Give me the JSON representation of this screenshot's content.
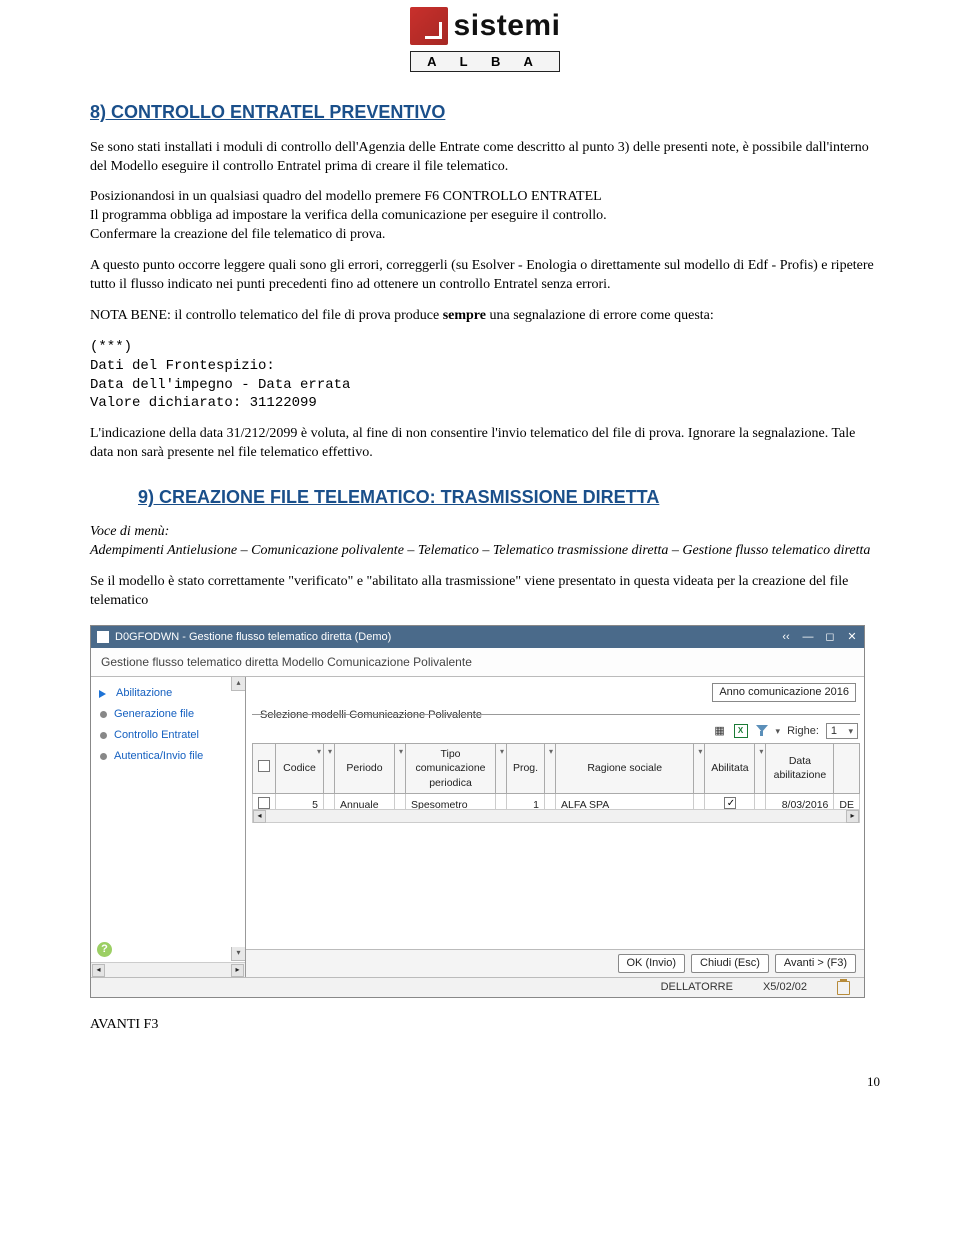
{
  "logo": {
    "brand": "sistemi",
    "bar": "A L B A"
  },
  "h8": "8)  CONTROLLO ENTRATEL PREVENTIVO",
  "p1": "Se sono stati installati i moduli di controllo dell'Agenzia delle Entrate come descritto al punto 3) delle presenti note, è possibile dall'interno del Modello eseguire il controllo Entratel prima di creare il file telematico.",
  "p2a": "Posizionandosi in un qualsiasi quadro del modello premere F6 CONTROLLO ENTRATEL",
  "p2b": "Il programma obbliga ad impostare la verifica della comunicazione per eseguire il controllo.",
  "p2c": "Confermare la creazione del file telematico di prova.",
  "p3": "A questo punto occorre leggere quali sono gli errori, correggerli (su Esolver - Enologia o direttamente sul modello di Edf - Profis) e ripetere tutto il flusso indicato nei punti precedenti fino ad ottenere un controllo Entratel senza errori.",
  "p4a": "NOTA BENE: il controllo telematico del file di prova produce ",
  "p4b": "sempre",
  "p4c": " una segnalazione di errore come questa:",
  "mono": {
    "l1": "(***)",
    "l2": "Dati del Frontespizio:",
    "l3": "Data dell'impegno - Data errata",
    "l4": "Valore dichiarato: 31122099"
  },
  "p5": "L'indicazione della data 31/212/2099 è voluta, al fine di non consentire l'invio telematico del file di prova. Ignorare la segnalazione. Tale data non sarà presente nel file telematico effettivo.",
  "h9": "9)  CREAZIONE FILE TELEMATICO: TRASMISSIONE DIRETTA",
  "voce": "Voce di menù:",
  "voce_path": "Adempimenti Antielusione – Comunicazione polivalente – Telematico – Telematico trasmissione diretta – Gestione flusso telematico diretta",
  "p6": "Se il modello è stato correttamente \"verificato\" e \"abilitato alla trasmissione\" viene presentato in questa videata per la creazione del file telematico",
  "app": {
    "title": "D0GFODWN - Gestione flusso telematico diretta  (Demo)",
    "subtitle": "Gestione flusso telematico diretta Modello Comunicazione Polivalente",
    "sidebar": {
      "items": [
        "Abilitazione",
        "Generazione file",
        "Controllo Entratel",
        "Autentica/Invio file"
      ]
    },
    "anno": "Anno comunicazione 2016",
    "section_label": "Selezione modelli Comunicazione Polivalente",
    "tools": {
      "righe_label": "Righe:",
      "righe_val": "1"
    },
    "grid": {
      "headers": [
        "",
        "Codice",
        "",
        "Periodo",
        "",
        "Tipo comunicazione periodica",
        "",
        "Prog.",
        "",
        "Ragione sociale",
        "",
        "Abilitata",
        "",
        "Data abilitazione",
        ""
      ],
      "row": {
        "codice": "5",
        "periodo": "Annuale",
        "tipo": "Spesometro",
        "prog": "1",
        "ragione": "ALFA SPA",
        "abil": true,
        "data_abil": "8/03/2016",
        "extra": "DE"
      }
    },
    "buttons": {
      "ok": "OK (Invio)",
      "chiudi": "Chiudi (Esc)",
      "avanti": "Avanti > (F3)"
    },
    "status": {
      "user": "DELLATORRE",
      "date": "X5/02/02"
    }
  },
  "below": "AVANTI F3",
  "page_num": "10"
}
